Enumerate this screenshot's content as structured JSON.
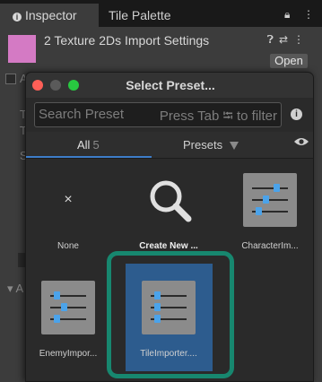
{
  "tabs": {
    "inspector": "Inspector",
    "tile_palette": "Tile Palette"
  },
  "header": {
    "title": "2 Texture 2Ds Import Settings",
    "swatch_color": "#d47ac4",
    "open_label": "Open"
  },
  "background_fragments": {
    "a1": "A",
    "t1": "T",
    "t2": "T",
    "s1": "S",
    "a2": "A"
  },
  "dialog": {
    "title": "Select Preset...",
    "search_placeholder": "Search Preset",
    "search_hint": "Press Tab ⭾ to filter",
    "filters": {
      "all": "All",
      "all_count": "5",
      "presets": "Presets"
    },
    "items": [
      {
        "name": "None",
        "icon": "x-icon"
      },
      {
        "name": "Create New ...",
        "icon": "magnifier-icon"
      },
      {
        "name": "CharacterIm...",
        "icon": "preset-sliders-icon"
      },
      {
        "name": "EnemyImpor...",
        "icon": "preset-sliders-icon"
      },
      {
        "name": "TileImporter....",
        "icon": "preset-sliders-icon",
        "selected": true
      }
    ]
  },
  "colors": {
    "accent_blue": "#3d7dc8",
    "selection": "#2d5c8e",
    "highlight": "#17876f",
    "knob": "#4ba3ea"
  }
}
